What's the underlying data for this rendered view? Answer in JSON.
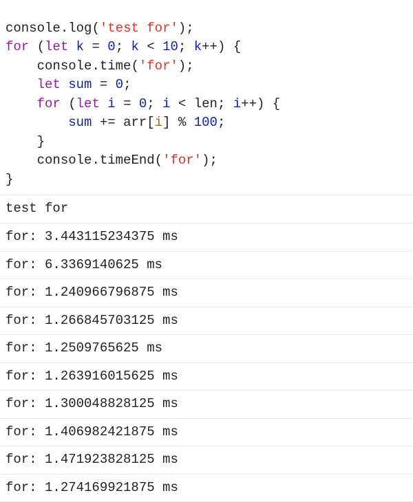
{
  "code": {
    "l1": {
      "log": "log",
      "str": "'test for'"
    },
    "l2": {
      "for": "for",
      "let": "let",
      "k": "k",
      "eq": "=",
      "zero": "0",
      "lt": "<",
      "ten": "10",
      "pp": "++"
    },
    "l3": {
      "time": "time",
      "str": "'for'"
    },
    "l4": {
      "let": "let",
      "sum": "sum",
      "eq": "=",
      "zero": "0"
    },
    "l5": {
      "for": "for",
      "let": "let",
      "i": "i",
      "eq": "=",
      "zero": "0",
      "lt": "<",
      "len": "len",
      "pp": "++"
    },
    "l6": {
      "sum": "sum",
      "pe": "+=",
      "arr": "arr",
      "i": "i",
      "mod": "%",
      "hundred": "100"
    },
    "l7": {
      "timeEnd": "timeEnd",
      "str": "'for'"
    }
  },
  "console_obj": "console",
  "output": {
    "header": "test for",
    "lines": [
      "for: 3.443115234375 ms",
      "for: 6.3369140625 ms",
      "for: 1.240966796875 ms",
      "for: 1.266845703125 ms",
      "for: 1.2509765625 ms",
      "for: 1.263916015625 ms",
      "for: 1.300048828125 ms",
      "for: 1.406982421875 ms",
      "for: 1.471923828125 ms",
      "for: 1.274169921875 ms"
    ]
  }
}
